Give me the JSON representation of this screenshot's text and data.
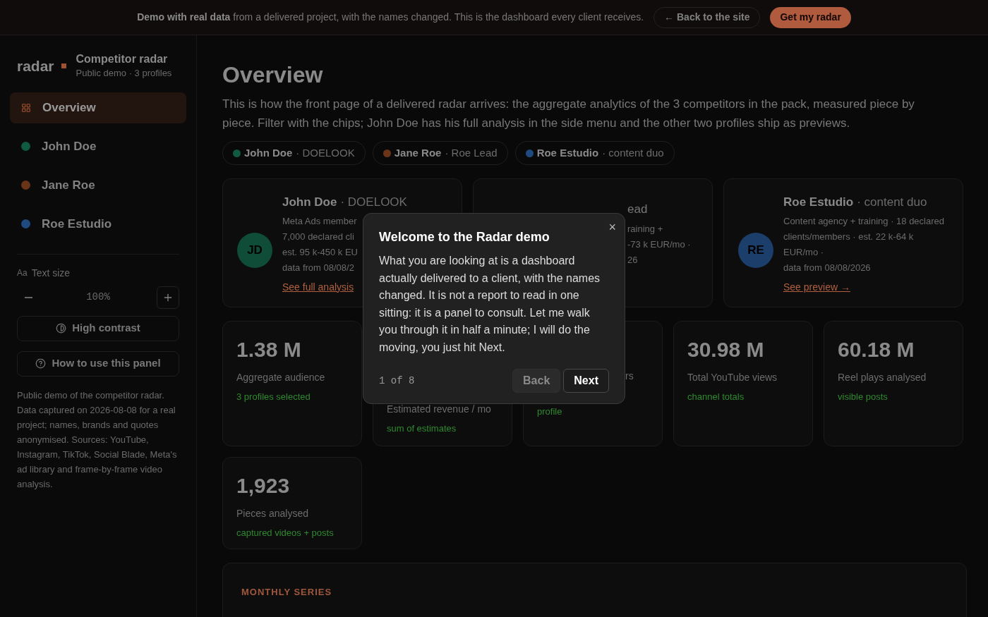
{
  "banner": {
    "lead": "Demo with real data",
    "text": "from a delivered project, with the names changed. This is the dashboard every client receives.",
    "back_link": "← Back to the site",
    "cta": "Get my radar"
  },
  "sidebar": {
    "logo": "radar",
    "title": "Competitor radar",
    "subtitle": "Public demo · 3 profiles",
    "nav": [
      {
        "kind": "overview",
        "label": "Overview",
        "selected": true
      },
      {
        "kind": "profile",
        "label": "John Doe",
        "color": "#0f5a40",
        "selected": false
      },
      {
        "kind": "profile",
        "label": "Jane Roe",
        "color": "#6a3418",
        "selected": false
      },
      {
        "kind": "profile",
        "label": "Roe Estudio",
        "color": "#1f4a80",
        "selected": false
      }
    ],
    "text_size": {
      "icon": "Aa",
      "label": "Text size",
      "value": "100%"
    },
    "buttons": [
      {
        "kind": "contrast",
        "label": "High contrast"
      },
      {
        "kind": "help",
        "label": "How to use this panel"
      }
    ],
    "note": "Public demo of the competitor radar. Data captured on 2026-08-08 for a real project; names, brands and quotes anonymised. Sources: YouTube, Instagram, TikTok, Social Blade, Meta's ad library and frame-by-frame video analysis."
  },
  "main": {
    "title": "Overview",
    "intro": "This is how the front page of a delivered radar arrives: the aggregate analytics of the 3 competitors in the pack, measured piece by piece. Filter with the chips; John Doe has his full analysis in the side menu and the other two profiles ship as previews.",
    "chips": [
      {
        "name": "John Doe",
        "tag": "· DOELOOK",
        "color": "#0f5a40"
      },
      {
        "name": "Jane Roe",
        "tag": "· Roe Lead",
        "color": "#6a3418"
      },
      {
        "name": "Roe Estudio",
        "tag": "· content duo",
        "color": "#1f4a80"
      }
    ],
    "profile_cards": [
      {
        "kind": "full",
        "initials": "JD",
        "color": "#0f4d38",
        "name": "John Doe",
        "tag": "· DOELOOK",
        "lines": [
          "Meta Ads member",
          "7,000 declared cli",
          "est. 95 k-450 k EU",
          "data from 08/08/2"
        ],
        "link": "See full analysis"
      },
      {
        "kind": "covered",
        "name": "ead",
        "lines": [
          "raining +",
          "-73 k EUR/mo ·",
          "26"
        ]
      },
      {
        "kind": "full",
        "initials": "RE",
        "color": "#1b3e6a",
        "name": "Roe Estudio",
        "tag": "· content duo",
        "lines": [
          "Content agency + training · 18 declared clients/members · est. 22 k-64 k EUR/mo ·",
          "data from 08/08/2026"
        ],
        "link": "See preview →"
      }
    ],
    "stats": [
      {
        "kind": "full",
        "value": "1.38 M",
        "label": "Aggregate audience",
        "note": "3 profiles selected"
      },
      {
        "kind": "covered",
        "label": "Estimated revenue / mo",
        "note": "sum of estimates"
      },
      {
        "kind": "cut",
        "label": "rs",
        "note": "profile"
      },
      {
        "kind": "full",
        "value": "30.98 M",
        "label": "Total YouTube views",
        "note": "channel totals"
      },
      {
        "kind": "full",
        "value": "60.18 M",
        "label": "Reel plays analysed",
        "note": "visible posts"
      },
      {
        "kind": "full",
        "value": "1,923",
        "label": "Pieces analysed",
        "note": "captured videos + posts"
      }
    ],
    "series": {
      "eyebrow": "MONTHLY SERIES"
    }
  },
  "modal": {
    "title": "Welcome to the Radar demo",
    "body": "What you are looking at is a dashboard actually delivered to a client, with the names changed. It is not a report to read in one sitting: it is a panel to consult. Let me walk you through it in half a minute; I will do the moving, you just hit Next.",
    "step": "1 of 8",
    "close": "×",
    "back": "Back",
    "next": "Next"
  }
}
